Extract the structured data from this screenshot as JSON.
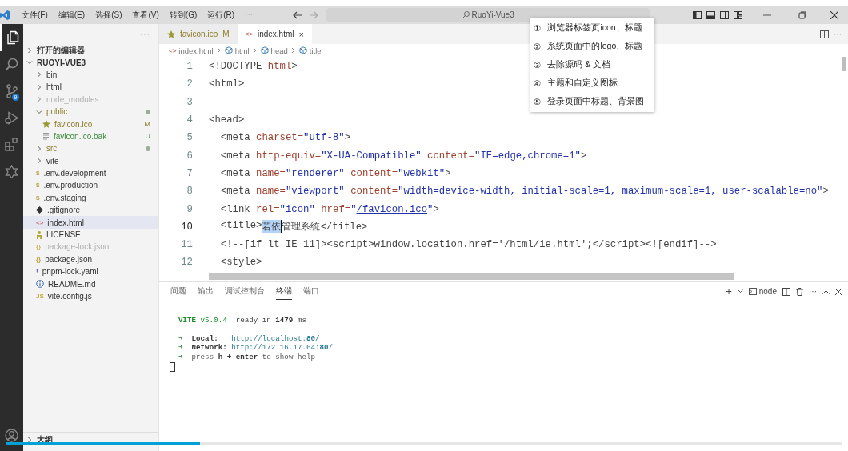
{
  "titlebar": {
    "menus": [
      "文件(F)",
      "编辑(E)",
      "选择(S)",
      "查看(V)",
      "转到(G)",
      "运行(R)",
      "···"
    ],
    "search": {
      "value": "RuoYi-Vue3"
    }
  },
  "activity_bar": {
    "items": [
      {
        "kind": "files",
        "selected": true
      },
      {
        "kind": "search",
        "selected": false
      },
      {
        "kind": "source-control",
        "selected": false,
        "badge": "9"
      },
      {
        "kind": "run-debug",
        "selected": false
      },
      {
        "kind": "extensions",
        "selected": false
      },
      {
        "kind": "star",
        "selected": false
      }
    ]
  },
  "sidebar": {
    "more": "···",
    "sections": [
      {
        "label": "打开的编辑器",
        "expanded": false
      },
      {
        "label": "RUOYI-VUE3",
        "expanded": true,
        "children": [
          {
            "name": "bin",
            "kind": "folder",
            "expanded": false,
            "selected": false,
            "modified": false,
            "untracked": false,
            "ignored": false
          },
          {
            "name": "html",
            "kind": "folder",
            "expanded": false,
            "selected": false,
            "modified": false,
            "untracked": false,
            "ignored": false
          },
          {
            "name": "node_modules",
            "kind": "folder",
            "expanded": false,
            "selected": false,
            "modified": false,
            "untracked": false,
            "ignored": true
          },
          {
            "name": "public",
            "kind": "folder",
            "expanded": true,
            "selected": false,
            "modified": true,
            "untracked": false,
            "ignored": false,
            "children": [
              {
                "name": "favicon.ico",
                "kind": "star",
                "selected": false,
                "modified": true,
                "untracked": false,
                "ignored": false,
                "badge": "M"
              },
              {
                "name": "favicon.ico.bak",
                "kind": "lines",
                "selected": false,
                "modified": false,
                "untracked": true,
                "ignored": false,
                "badge": "U"
              }
            ]
          },
          {
            "name": "src",
            "kind": "folder",
            "expanded": false,
            "selected": false,
            "modified": true,
            "untracked": false,
            "ignored": false
          },
          {
            "name": "vite",
            "kind": "folder",
            "expanded": false,
            "selected": false,
            "modified": false,
            "untracked": false,
            "ignored": false
          },
          {
            "name": ".env.development",
            "kind": "dollar",
            "glyph": "$",
            "selected": false,
            "modified": false,
            "untracked": false,
            "ignored": false
          },
          {
            "name": ".env.production",
            "kind": "dollar",
            "glyph": "$",
            "selected": false,
            "modified": false,
            "untracked": false,
            "ignored": false
          },
          {
            "name": ".env.staging",
            "kind": "dollar",
            "glyph": "$",
            "selected": false,
            "modified": false,
            "untracked": false,
            "ignored": false
          },
          {
            "name": ".gitignore",
            "kind": "diamond",
            "selected": false,
            "modified": false,
            "untracked": false,
            "ignored": false
          },
          {
            "name": "index.html",
            "kind": "code",
            "glyph": "<>",
            "selected": true,
            "modified": false,
            "untracked": false,
            "ignored": false
          },
          {
            "name": "LICENSE",
            "kind": "person",
            "selected": false,
            "modified": false,
            "untracked": false,
            "ignored": false
          },
          {
            "name": "package-lock.json",
            "kind": "braces",
            "glyph": "{}",
            "selected": false,
            "modified": false,
            "untracked": false,
            "ignored": true
          },
          {
            "name": "package.json",
            "kind": "braces",
            "glyph": "{}",
            "selected": false,
            "modified": false,
            "untracked": false,
            "ignored": false
          },
          {
            "name": "pnpm-lock.yaml",
            "kind": "bang",
            "glyph": "!",
            "selected": false,
            "modified": false,
            "untracked": false,
            "ignored": false
          },
          {
            "name": "README.md",
            "kind": "info",
            "selected": false,
            "modified": false,
            "untracked": false,
            "ignored": false
          },
          {
            "name": "vite.config.js",
            "kind": "js",
            "glyph": "JS",
            "selected": false,
            "modified": false,
            "untracked": false,
            "ignored": false
          }
        ]
      }
    ],
    "footer": [
      {
        "label": "大纲",
        "expanded": false
      }
    ]
  },
  "editor": {
    "tabs": [
      {
        "label": "favicon.ico",
        "kind": "star",
        "badge": "M",
        "modified": true,
        "selected": false
      },
      {
        "label": "index.html",
        "kind": "code",
        "glyph": "<>",
        "close": "×",
        "modified": false,
        "selected": true
      }
    ],
    "more": "···",
    "breadcrumb": [
      {
        "label": "index.html",
        "kind": "code",
        "glyph": "<>"
      },
      {
        "label": "html",
        "kind": "cube"
      },
      {
        "label": "head",
        "kind": "cube"
      },
      {
        "label": "title",
        "kind": "cube"
      }
    ],
    "lines": [
      {
        "number": "1",
        "current": false,
        "text": "<!DOCTYPE html>"
      },
      {
        "number": "2",
        "current": false,
        "text": "<html>"
      },
      {
        "number": "3",
        "current": false
      },
      {
        "number": "4",
        "current": false,
        "text": "<head>"
      },
      {
        "number": "5",
        "current": false,
        "text": "  <meta charset=\"utf-8\">"
      },
      {
        "number": "6",
        "current": false,
        "text": "  <meta http-equiv=\"X-UA-Compatible\" content=\"IE=edge,chrome=1\">"
      },
      {
        "number": "7",
        "current": false,
        "text": "  <meta name=\"renderer\" content=\"webkit\">"
      },
      {
        "number": "8",
        "current": false,
        "text": "  <meta name=\"viewport\" content=\"width=device-width, initial-scale=1, maximum-scale=1, user-scalable=no\">"
      },
      {
        "number": "9",
        "current": false,
        "text": "  <link rel=\"icon\" href=\"/favicon.ico\">"
      },
      {
        "number": "10",
        "current": true,
        "segments": [
          {
            "text": "  <title>",
            "selected": false
          },
          {
            "text": "若依",
            "selected": true
          },
          {
            "text": "管理系统</title>",
            "selected": false
          }
        ]
      },
      {
        "number": "11",
        "current": false,
        "text": "  <!--[if lt IE 11]><script>window.location.href='/html/ie.html';</script><![endif]-->"
      },
      {
        "number": "12",
        "current": false,
        "text": "  <style>"
      }
    ]
  },
  "panel": {
    "tabs": [
      {
        "label": "问题",
        "selected": false
      },
      {
        "label": "输出",
        "selected": false
      },
      {
        "label": "调试控制台",
        "selected": false
      },
      {
        "label": "终端",
        "selected": true
      },
      {
        "label": "端口",
        "selected": false
      }
    ],
    "actions": {
      "add": "+",
      "shell": "node",
      "more": "···"
    },
    "terminal": [
      {
        "kind": "banner",
        "text": "**VITE** v5.0.4  ready in **1479** ms"
      },
      {
        "kind": "link",
        "text": "➜  **Local:**   http://localhost:**80**/"
      },
      {
        "kind": "link",
        "text": "➜  **Network:** http://172.16.17.64:**80**/"
      },
      {
        "kind": "hint",
        "text": "➜  press **h + enter** to show help"
      }
    ]
  },
  "menu": {
    "items": [
      {
        "marker": "①",
        "label": "浏览器标签页icon、标题"
      },
      {
        "marker": "②",
        "label": "系统页面中的logo、标题"
      },
      {
        "marker": "③",
        "label": "去除源码 & 文档"
      },
      {
        "marker": "④",
        "label": "主题和自定义图标"
      },
      {
        "marker": "⑤",
        "label": "登录页面中标题、背景图"
      }
    ]
  },
  "video_progress": {
    "level": 0.232
  }
}
